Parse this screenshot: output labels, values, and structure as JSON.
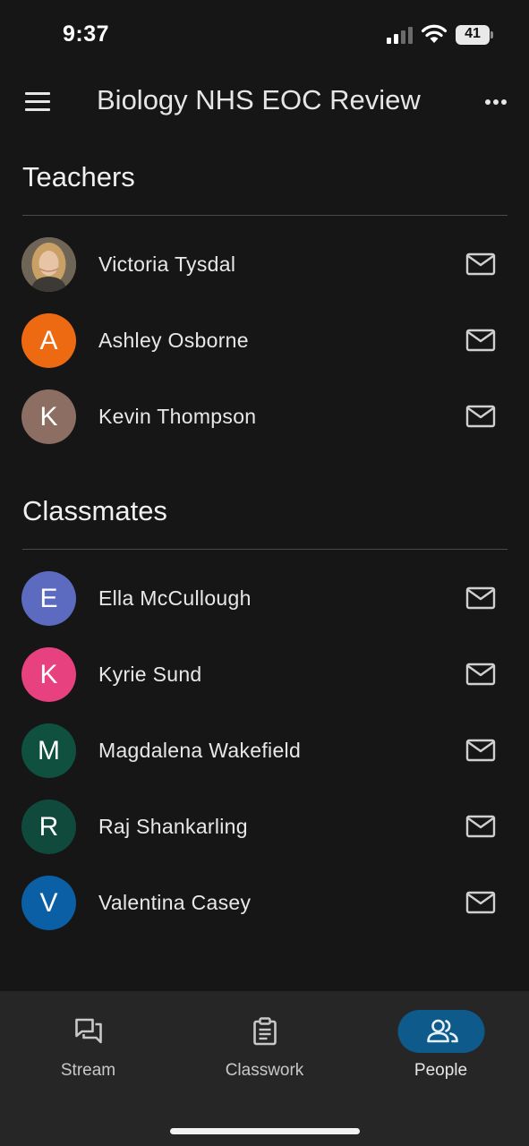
{
  "status_bar": {
    "time": "9:37",
    "battery": "41"
  },
  "app_bar": {
    "title": "Biology NHS EOC Review",
    "menu_icon": "hamburger-menu-icon",
    "more_icon": "more-options-icon"
  },
  "teachers": {
    "heading": "Teachers",
    "people": [
      {
        "name": "Victoria Tysdal",
        "initial": "",
        "avatar_type": "photo",
        "color": "#8a7560"
      },
      {
        "name": "Ashley Osborne",
        "initial": "A",
        "avatar_type": "initial",
        "color": "#ee6a12"
      },
      {
        "name": "Kevin Thompson",
        "initial": "K",
        "avatar_type": "initial",
        "color": "#8d6e63"
      }
    ]
  },
  "classmates": {
    "heading": "Classmates",
    "people": [
      {
        "name": "Ella McCullough",
        "initial": "E",
        "avatar_type": "initial",
        "color": "#5c6bc0"
      },
      {
        "name": "Kyrie Sund",
        "initial": "K",
        "avatar_type": "initial",
        "color": "#e8417f"
      },
      {
        "name": "Magdalena Wakefield",
        "initial": "M",
        "avatar_type": "initial",
        "color": "#10503f"
      },
      {
        "name": "Raj Shankarling",
        "initial": "R",
        "avatar_type": "initial",
        "color": "#104a3c"
      },
      {
        "name": "Valentina Casey",
        "initial": "V",
        "avatar_type": "initial",
        "color": "#0b5fa5"
      }
    ]
  },
  "bottom_nav": {
    "items": [
      {
        "label": "Stream",
        "icon": "stream-icon",
        "active": false
      },
      {
        "label": "Classwork",
        "icon": "classwork-icon",
        "active": false
      },
      {
        "label": "People",
        "icon": "people-icon",
        "active": true
      }
    ]
  },
  "colors": {
    "background": "#161616",
    "nav_background": "#262626",
    "active_pill": "#0e5a8a"
  }
}
